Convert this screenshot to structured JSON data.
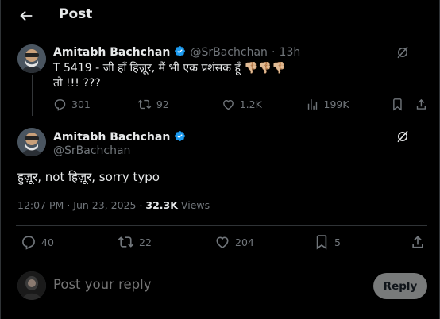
{
  "header": {
    "title": "Post"
  },
  "quoted_tweet": {
    "author": "Amitabh Bachchan",
    "handle": "@SrBachchan",
    "sep": "·",
    "time_ago": "13h",
    "line1": "T 5419 - जी हाँ हिज़ूर, मैं भी एक प्रशंसक हूँ 👎🏼👎🏼👎🏼",
    "line2": "तो !!! ???",
    "stats": {
      "replies": "301",
      "reposts": "92",
      "likes": "1.2K",
      "views": "199K"
    }
  },
  "main_tweet": {
    "author": "Amitabh Bachchan",
    "handle": "@SrBachchan",
    "text": "हुज़ूर, not हिज़ूर, sorry typo",
    "time": "12:07 PM",
    "date_sep": "·",
    "date": "Jun 23, 2025",
    "views_count": "32.3K",
    "views_label": "Views",
    "stats": {
      "replies": "40",
      "reposts": "22",
      "likes": "204",
      "bookmarks": "5"
    }
  },
  "composer": {
    "placeholder": "Post your reply",
    "button": "Reply"
  },
  "colors": {
    "background": "#000000",
    "text": "#e7e9ea",
    "muted": "#71767b",
    "verified": "#1d9bf0",
    "divider": "#2f3336"
  },
  "icons": [
    "back-arrow-icon",
    "verified-badge-icon",
    "grok-icon",
    "reply-icon",
    "repost-icon",
    "like-icon",
    "views-icon",
    "bookmark-icon",
    "share-icon"
  ]
}
